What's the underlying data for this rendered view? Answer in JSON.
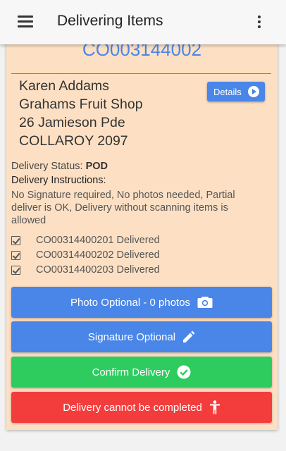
{
  "appbar": {
    "title": "Delivering Items"
  },
  "delivery": {
    "order_number": "CO003144002",
    "address": [
      "Karen Addams",
      "Grahams Fruit Shop",
      "26 Jamieson Pde",
      "COLLAROY 2097"
    ],
    "details_label": "Details",
    "status_label": "Delivery Status:",
    "status_value": "POD",
    "instructions_label": "Delivery Instructions:",
    "instructions": "No Signature required, No photos needed, Partial deliver is OK, Delivery without scanning items is allowed",
    "items": [
      {
        "text": "CO00314400201 Delivered",
        "checked": true
      },
      {
        "text": "CO00314400202 Delivered",
        "checked": true
      },
      {
        "text": "CO00314400203 Delivered",
        "checked": true
      }
    ]
  },
  "actions": {
    "photo": "Photo Optional - 0 photos",
    "signature": "Signature Optional",
    "confirm": "Confirm Delivery",
    "cannot": "Delivery cannot be completed"
  },
  "icons": {
    "menu": "hamburger-icon",
    "more": "more-vert-icon",
    "details": "play-circle-icon",
    "photo": "camera-icon",
    "signature": "pencil-icon",
    "confirm": "check-circle-icon",
    "cannot": "person-icon"
  },
  "colors": {
    "accent": "#4a86e8",
    "confirm": "#2ecc5f",
    "danger": "#f33d3d",
    "card": "#fde0c4"
  }
}
